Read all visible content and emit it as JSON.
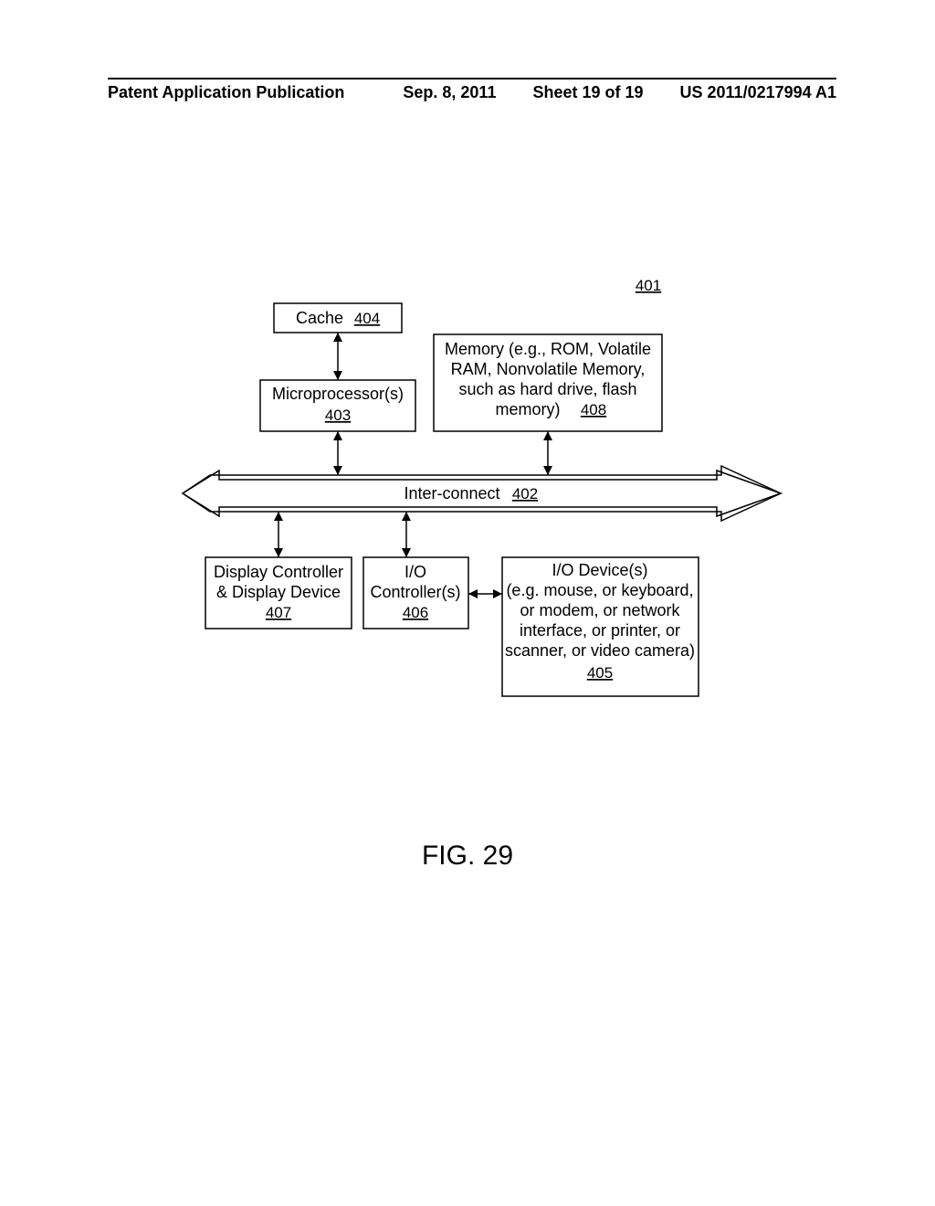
{
  "header": {
    "left": "Patent Application Publication",
    "date": "Sep. 8, 2011",
    "sheet": "Sheet 19 of 19",
    "docnum": "US 2011/0217994 A1"
  },
  "ref_system": "401",
  "blocks": {
    "cache": {
      "label": "Cache",
      "ref": "404"
    },
    "micro": {
      "label": "Microprocessor(s)",
      "ref": "403"
    },
    "memory": {
      "l1": "Memory (e.g., ROM, Volatile",
      "l2": "RAM, Nonvolatile Memory,",
      "l3": "such as hard drive, flash",
      "l4": "memory)",
      "ref": "408"
    },
    "interconnect": {
      "label": "Inter-connect",
      "ref": "402"
    },
    "display": {
      "l1": "Display Controller",
      "l2": "& Display Device",
      "ref": "407"
    },
    "ioctrl": {
      "l1": "I/O",
      "l2": "Controller(s)",
      "ref": "406"
    },
    "iodev": {
      "l1": "I/O Device(s)",
      "l2": "(e.g. mouse, or keyboard,",
      "l3": "or modem, or network",
      "l4": "interface, or printer, or",
      "l5": "scanner, or video camera)",
      "ref": "405"
    }
  },
  "figure_caption": "FIG. 29"
}
